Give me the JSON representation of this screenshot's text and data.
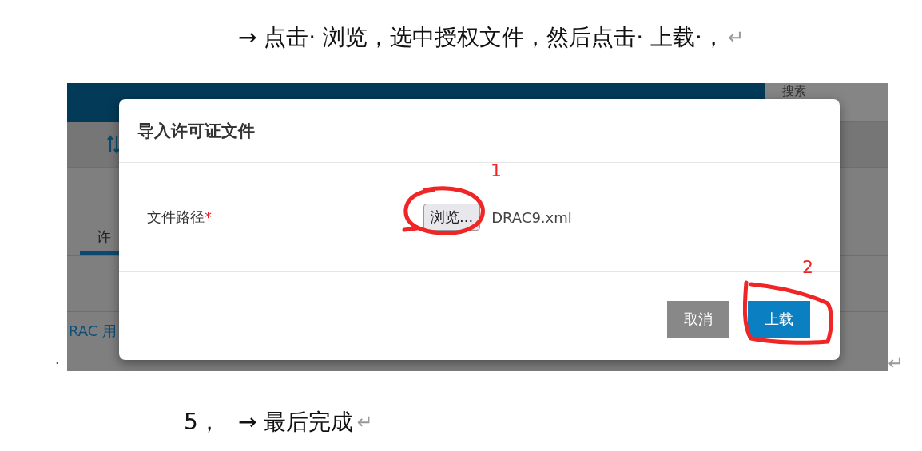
{
  "instruction": {
    "text": "→ 点击· 浏览，选中授权文件，然后点击· 上载·，",
    "mark": "↵"
  },
  "screenshot": {
    "background": {
      "search_label": "搜索",
      "tab_label": "许",
      "link_text": "RAC 用"
    },
    "dialog": {
      "title": "导入许可证文件",
      "field_label": "文件路径",
      "required_mark": "*",
      "browse_button": "浏览...",
      "file_name": "DRAC9.xml",
      "buttons": [
        {
          "label": "取消",
          "kind": "secondary"
        },
        {
          "label": "上载",
          "kind": "primary"
        }
      ]
    },
    "annotations": [
      "1",
      "2"
    ]
  },
  "image_line": {
    "lead": "·",
    "mark": "↵"
  },
  "final_step": {
    "number": "5，",
    "text": "→ 最后完成",
    "mark": "↵"
  }
}
